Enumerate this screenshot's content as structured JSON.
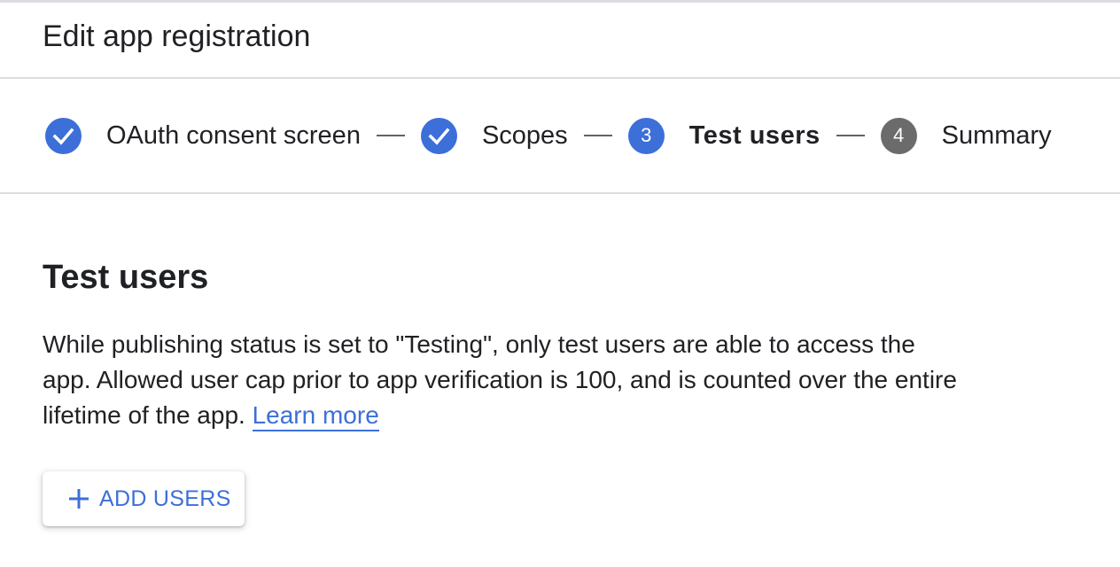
{
  "header": {
    "title": "Edit app registration"
  },
  "stepper": {
    "steps": [
      {
        "badge": "check",
        "icon": "check-icon",
        "label": "OAuth consent screen",
        "state": "completed",
        "color": "#3c6fd8"
      },
      {
        "badge": "check",
        "icon": "check-icon",
        "label": "Scopes",
        "state": "completed",
        "color": "#3c6fd8"
      },
      {
        "badge": "3",
        "label": "Test users",
        "state": "active",
        "color": "#3c6fd8"
      },
      {
        "badge": "4",
        "label": "Summary",
        "state": "pending",
        "color": "#6b6b6b"
      }
    ]
  },
  "section": {
    "title": "Test users",
    "description": "While publishing status is set to \"Testing\", only test users are able to access the app. Allowed user cap prior to app verification is 100, and is counted over the entire lifetime of the app.",
    "learn_more_label": "Learn more"
  },
  "actions": {
    "add_users_label": "ADD USERS",
    "add_users_icon": "plus-icon"
  },
  "colors": {
    "accent": "#3c6fd8",
    "pending": "#6b6b6b",
    "divider": "#dadce0",
    "text": "#202124"
  }
}
